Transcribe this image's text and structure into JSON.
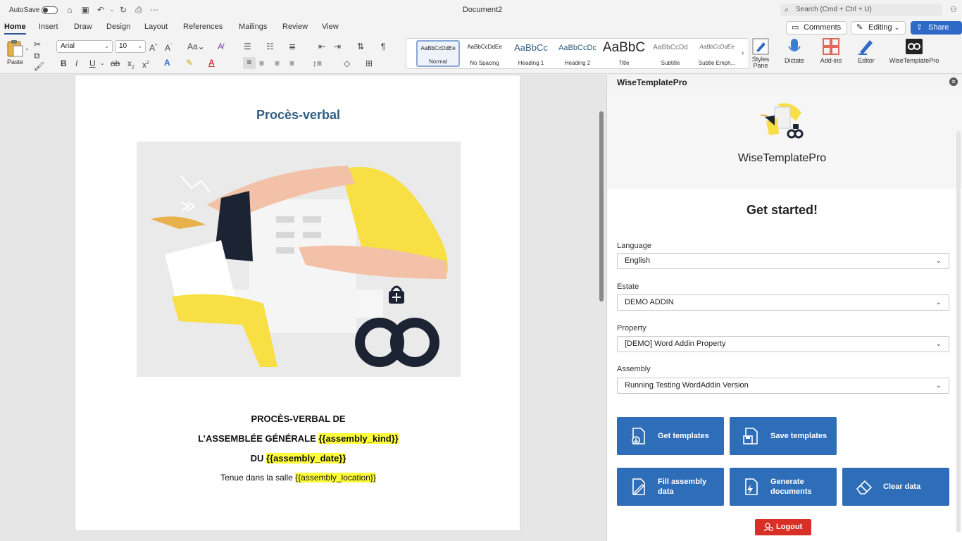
{
  "titlebar": {
    "autosave_label": "AutoSave",
    "doc_title": "Document2",
    "search_placeholder": "Search (Cmd + Ctrl + U)"
  },
  "tabs": [
    "Home",
    "Insert",
    "Draw",
    "Design",
    "Layout",
    "References",
    "Mailings",
    "Review",
    "View"
  ],
  "actions": {
    "comments": "Comments",
    "editing": "Editing",
    "share": "Share"
  },
  "ribbon": {
    "paste": "Paste",
    "font": "Arial",
    "size": "10",
    "styles": [
      {
        "sample": "AaBbCcDdEe",
        "name": "Normal"
      },
      {
        "sample": "AaBbCcDdEe",
        "name": "No Spacing"
      },
      {
        "sample": "AaBbCc",
        "name": "Heading 1"
      },
      {
        "sample": "AaBbCcDc",
        "name": "Heading 2"
      },
      {
        "sample": "AaBbC",
        "name": "Title"
      },
      {
        "sample": "AaBbCcDd",
        "name": "Subtitle"
      },
      {
        "sample": "AaBbCcDdEe",
        "name": "Subtle Emph..."
      }
    ],
    "styles_pane": "Styles Pane",
    "dictate": "Dictate",
    "addins": "Add-ins",
    "editor": "Editor",
    "wtp": "WiseTemplatePro"
  },
  "document": {
    "title": "Procès-verbal",
    "line1": "PROCÈS-VERBAL DE",
    "line2_prefix": "L’ASSEMBLÉE GÉNÉRALE ",
    "line2_ph": "{{assembly_kind}}",
    "line3_prefix": "DU ",
    "line3_ph": "{{assembly_date}}",
    "line4_prefix": "Tenue dans la salle ",
    "line4_ph": "{{assembly_location}}"
  },
  "pane": {
    "title": "WiseTemplatePro",
    "brand": "WiseTemplatePro",
    "heading": "Get started!",
    "fields": [
      {
        "label": "Language",
        "value": "English"
      },
      {
        "label": "Estate",
        "value": "DEMO ADDIN"
      },
      {
        "label": "Property",
        "value": "[DEMO] Word Addin Property"
      },
      {
        "label": "Assembly",
        "value": "Running Testing WordAddin Version"
      }
    ],
    "buttons": {
      "get_templates": "Get templates",
      "save_templates": "Save templates",
      "fill_assembly": "Fill assembly data",
      "generate_documents": "Generate documents",
      "clear_data": "Clear data"
    },
    "logout": "Logout"
  },
  "colors": {
    "accent": "#2e6db8",
    "logout": "#d93025",
    "title_blue": "#2f5e82",
    "highlight": "#ffff3a"
  }
}
